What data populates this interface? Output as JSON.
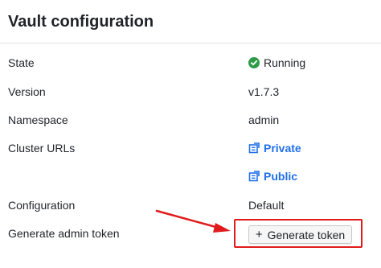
{
  "header": {
    "title": "Vault configuration"
  },
  "rows": [
    {
      "label": "State",
      "value": "Running"
    },
    {
      "label": "Version",
      "value": "v1.7.3"
    },
    {
      "label": "Namespace",
      "value": "admin"
    },
    {
      "label": "Cluster URLs",
      "links": [
        "Private",
        "Public"
      ]
    },
    {
      "label": "Configuration",
      "value": "Default"
    },
    {
      "label": "Generate admin token",
      "button": "Generate token",
      "button_icon": "+"
    }
  ],
  "colors": {
    "running": "#2e9b47",
    "link": "#1f6feb",
    "highlight": "#e11b1b",
    "arrow": "#e11b1b"
  }
}
